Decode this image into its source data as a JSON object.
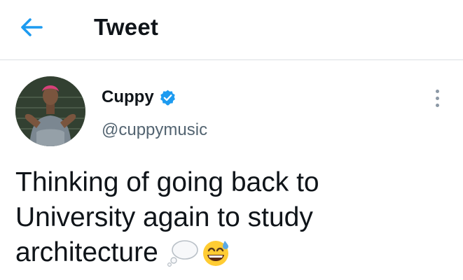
{
  "header": {
    "title": "Tweet",
    "back_icon": "arrow-left-icon",
    "accent_color": "#1d9bf0"
  },
  "tweet": {
    "author": {
      "display_name": "Cuppy",
      "handle": "@cuppymusic",
      "verified": true,
      "verified_icon": "verified-badge-icon"
    },
    "more_icon": "more-vertical-icon",
    "text_lines": [
      "Thinking of going back to",
      "University again to study",
      "architecture"
    ],
    "emojis": [
      "thought-balloon-emoji",
      "grinning-sweat-emoji"
    ]
  }
}
